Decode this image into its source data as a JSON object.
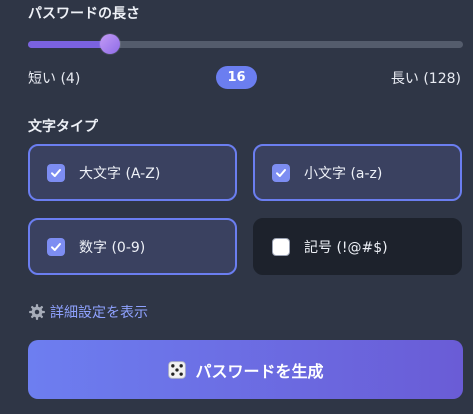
{
  "length": {
    "title": "パスワードの長さ",
    "min_label": "短い (4)",
    "max_label": "長い (128)",
    "value_text": "16",
    "value": 16,
    "min": 4,
    "max": 128
  },
  "char_types": {
    "title": "文字タイプ",
    "options": [
      {
        "label": "大文字 (A-Z)",
        "checked": true
      },
      {
        "label": "小文字 (a-z)",
        "checked": true
      },
      {
        "label": "数字 (0-9)",
        "checked": true
      },
      {
        "label": "記号 (!@#$)",
        "checked": false
      }
    ]
  },
  "advanced": {
    "label": "詳細設定を表示",
    "icon": "gear-icon"
  },
  "generate": {
    "label": "パスワードを生成",
    "icon": "dice-icon"
  },
  "colors": {
    "accent": "#6b7ef0",
    "background": "#2f3646",
    "link": "#8fa2ff"
  }
}
